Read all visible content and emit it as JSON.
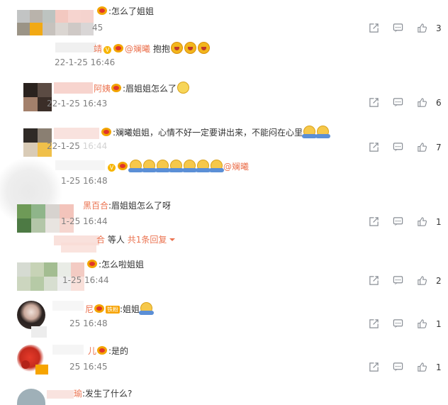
{
  "colors": {
    "accent": "#eb7350",
    "time": "#808080",
    "icon": "#9aa0a6",
    "badge": "#f7b500"
  },
  "comments": [
    {
      "name_suffix": "",
      "text": ":怎么了姐姐",
      "time": "45",
      "likes": "3"
    },
    {
      "name_suffix": "靖",
      "mention": "@斓曦",
      "text": " 抱抱",
      "time": "22-1-25 16:46"
    },
    {
      "name_suffix": "阿姨",
      "text": ":眉姐姐怎么了",
      "time": "22-1-25 16:43",
      "likes": "6"
    },
    {
      "text": ":斓曦姐姐，心情不好一定要讲出来，不能闷在心里",
      "time": "22-1-25 16:44",
      "time_visible": "22-1-25 ",
      "likes": "7"
    },
    {
      "name_suffix": "",
      "mention": "@斓曦",
      "time": "1-25 16:48"
    },
    {
      "name_suffix": "黑百合",
      "text": ":眉姐姐怎么了呀",
      "time": "1-25 16:44",
      "likes": "1"
    },
    {
      "name_suffix": "合",
      "reply_tail": "等人",
      "reply_count_label": "共1条回复"
    },
    {
      "text": ":怎么啦姐姐",
      "time": "1-25 16:44",
      "likes": "2"
    },
    {
      "name_suffix": "尼",
      "fan_badge": "铁粉",
      "text": ":姐姐",
      "time": "25 16:48",
      "likes": "1"
    },
    {
      "name_suffix": "儿",
      "text": ":是的",
      "time": "25 16:45",
      "likes": "1"
    },
    {
      "name_suffix": "瑜",
      "text": ":发生了什么?"
    }
  ],
  "icons": {
    "share": "share-icon",
    "comment": "comment-icon",
    "like": "thumbs-up-icon",
    "dropdown": "caret-down-icon"
  }
}
